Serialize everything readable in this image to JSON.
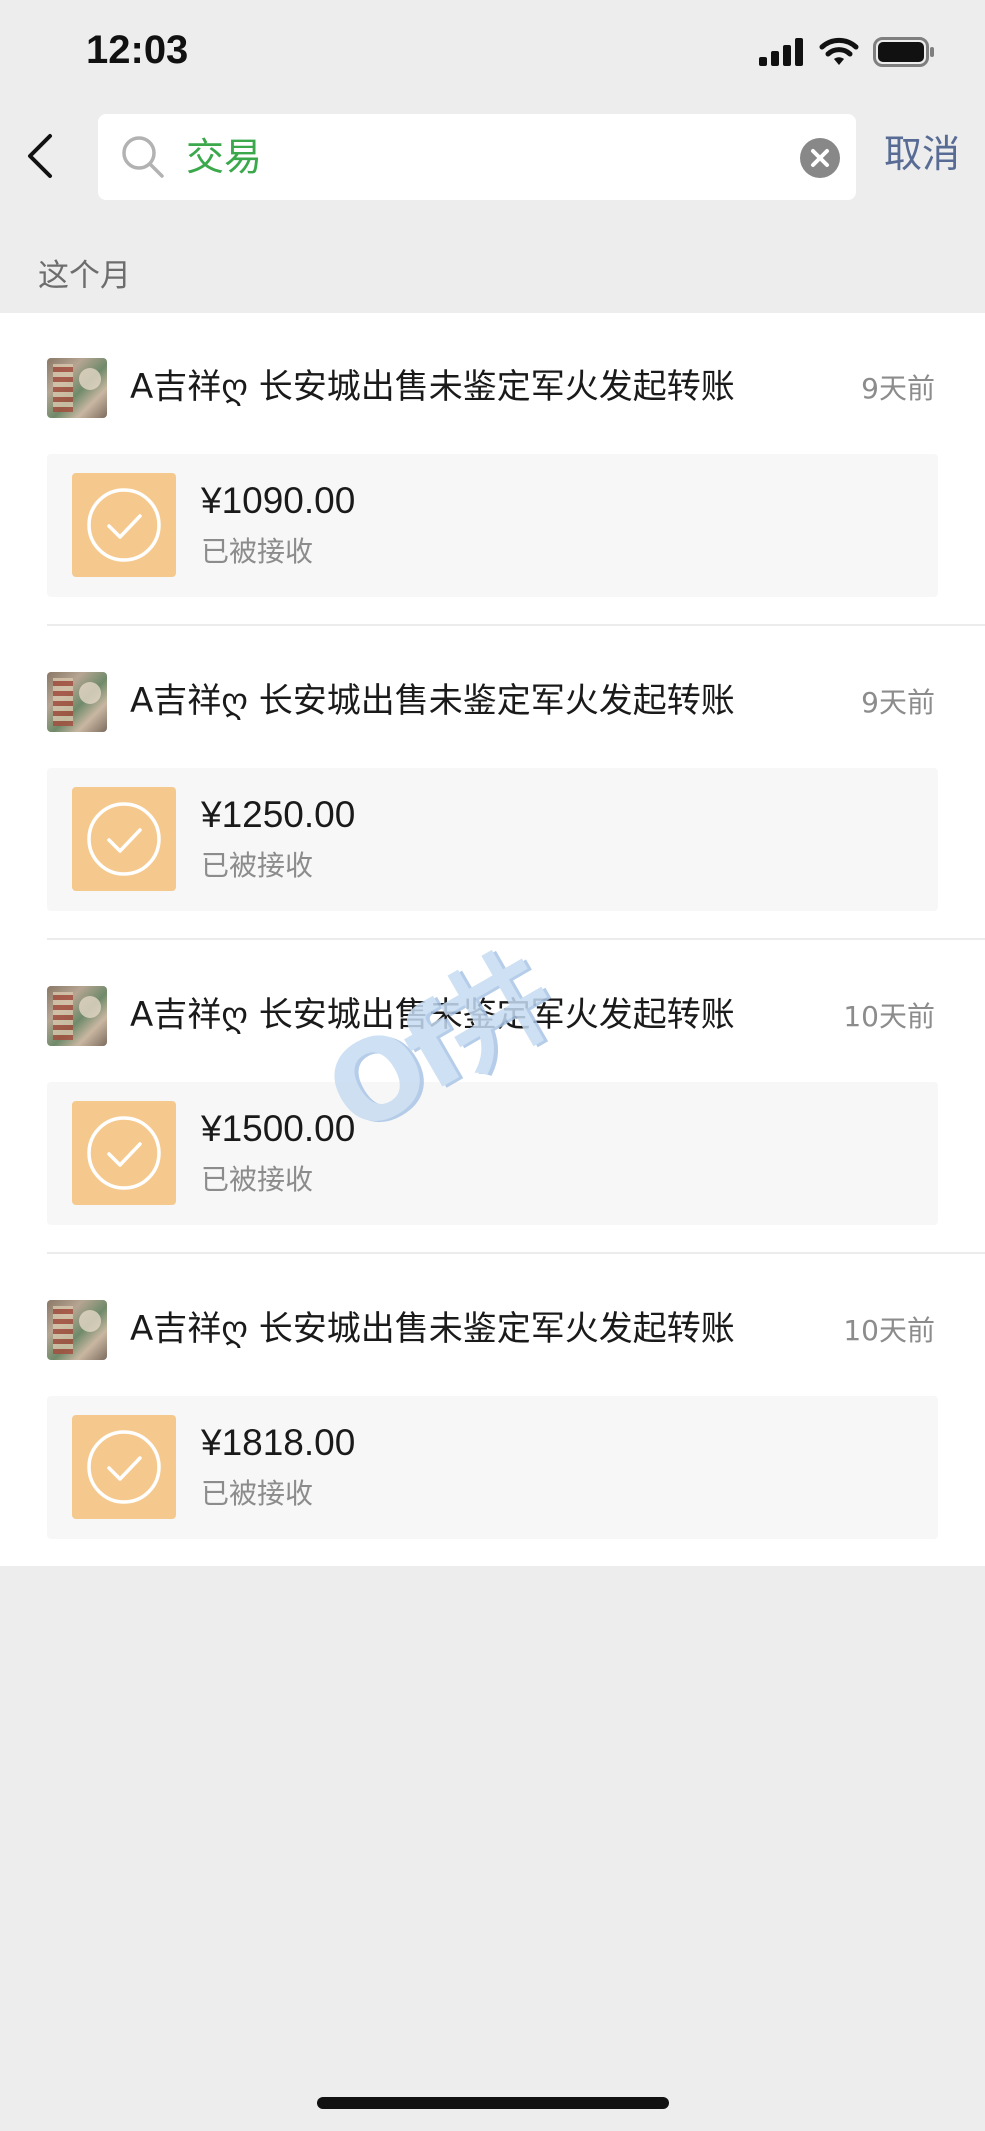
{
  "status_bar": {
    "time": "12:03"
  },
  "search": {
    "query": "交易",
    "cancel_label": "取消"
  },
  "section_label": "这个月",
  "transactions": [
    {
      "title": "A吉祥ღ 长安城出售未鉴定军火发起转账",
      "time": "9天前",
      "amount": "¥1090.00",
      "status": "已被接收"
    },
    {
      "title": "A吉祥ღ 长安城出售未鉴定军火发起转账",
      "time": "9天前",
      "amount": "¥1250.00",
      "status": "已被接收"
    },
    {
      "title": "A吉祥ღ 长安城出售未鉴定军火发起转账",
      "time": "10天前",
      "amount": "¥1500.00",
      "status": "已被接收"
    },
    {
      "title": "A吉祥ღ 长安城出售未鉴定军火发起转账",
      "time": "10天前",
      "amount": "¥1818.00",
      "status": "已被接收"
    }
  ],
  "watermark": "Of井",
  "colors": {
    "accent_green": "#3aa84b",
    "link_blue": "#576b95",
    "transfer_orange": "#f5c98d"
  }
}
